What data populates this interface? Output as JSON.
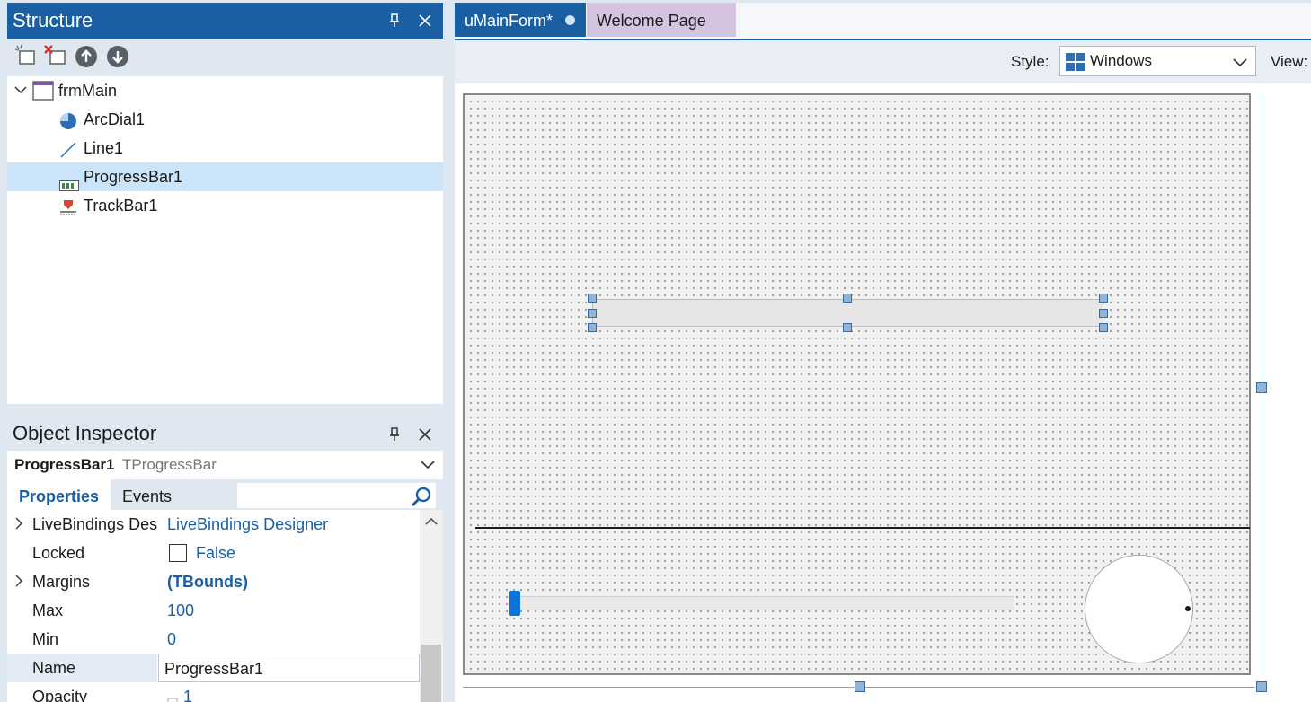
{
  "structure": {
    "title": "Structure",
    "tree": [
      {
        "label": "frmMain",
        "icon": "form-icon",
        "expanded": true
      },
      {
        "label": "ArcDial1",
        "icon": "arcdial-icon"
      },
      {
        "label": "Line1",
        "icon": "line-icon"
      },
      {
        "label": "ProgressBar1",
        "icon": "progressbar-icon",
        "selected": true
      },
      {
        "label": "TrackBar1",
        "icon": "trackbar-icon"
      }
    ]
  },
  "inspector": {
    "title": "Object Inspector",
    "object_name": "ProgressBar1",
    "object_type": "TProgressBar",
    "tabs": [
      "Properties",
      "Events"
    ],
    "properties": [
      {
        "name": "LiveBindings Designer",
        "value": "LiveBindings Designer",
        "expandable": true
      },
      {
        "name": "Locked",
        "value": "False",
        "checkbox": true
      },
      {
        "name": "Margins",
        "value": "(TBounds)",
        "expandable": true
      },
      {
        "name": "Max",
        "value": "100"
      },
      {
        "name": "Min",
        "value": "0"
      },
      {
        "name": "Name",
        "value": "ProgressBar1",
        "selected": true
      },
      {
        "name": "Opacity",
        "value": "1"
      }
    ]
  },
  "editor": {
    "tabs": [
      {
        "label": "uMainForm*",
        "active": true
      },
      {
        "label": "Welcome Page"
      }
    ],
    "style_label": "Style:",
    "style_value": "Windows",
    "view_label": "View:"
  },
  "colors": {
    "accent": "#1b5fa3",
    "selection": "#cce4f7",
    "welcome_tab": "#d4c4df",
    "trackbar_thumb": "#0a74da"
  }
}
